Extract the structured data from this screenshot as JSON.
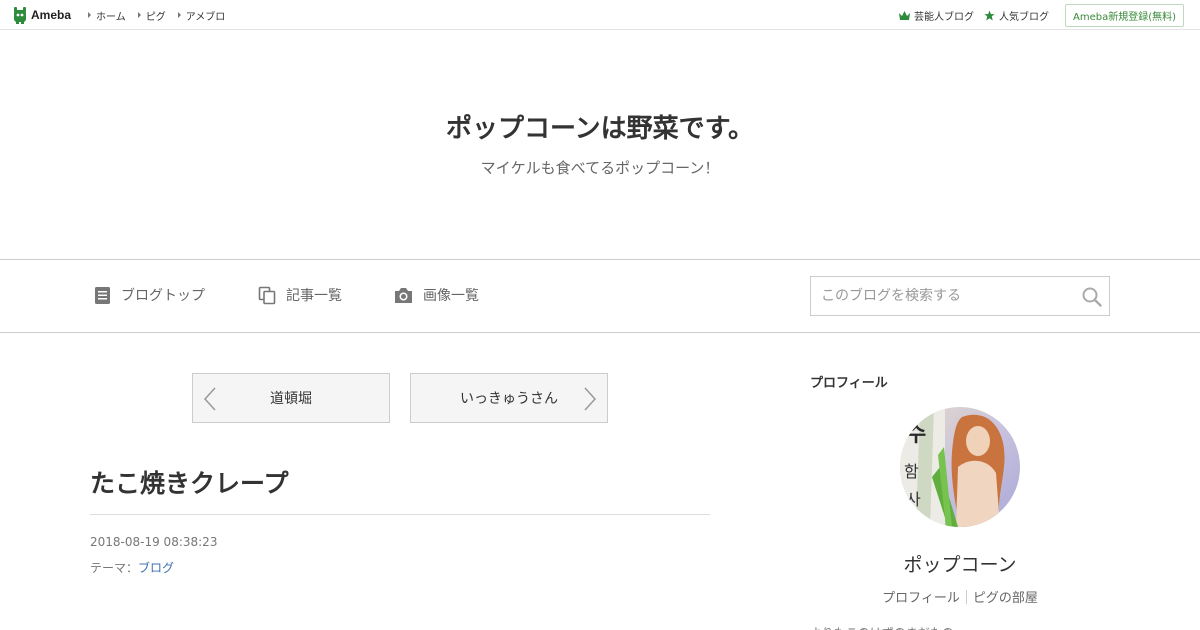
{
  "topbar": {
    "logo_text": "Ameba",
    "nav": [
      {
        "label": "ホーム"
      },
      {
        "label": "ピグ"
      },
      {
        "label": "アメブロ"
      }
    ],
    "right": {
      "celebrity_blog": "芸能人ブログ",
      "popular_blog": "人気ブログ",
      "register": "Ameba新規登録(無料)"
    },
    "accent_color": "#2d8c3c"
  },
  "header": {
    "title": "ポップコーンは野菜です。",
    "description": "マイケルも食べてるポップコーン！"
  },
  "global_nav": {
    "items": [
      {
        "label": "ブログトップ",
        "icon": "document-icon"
      },
      {
        "label": "記事一覧",
        "icon": "copy-icon"
      },
      {
        "label": "画像一覧",
        "icon": "camera-icon"
      }
    ],
    "search_placeholder": "このブログを検索する"
  },
  "pager": {
    "prev": "道頓堀",
    "next": "いっきゅうさん"
  },
  "entry": {
    "title": "たこ焼きクレープ",
    "date": "2018-08-19 08:38:23",
    "theme_label": "テーマ：",
    "theme_link": "ブログ"
  },
  "sidebar": {
    "heading": "プロフィール",
    "name": "ポップコーン",
    "links": [
      "プロフィール",
      "ピグの部屋"
    ],
    "cut_text": "よりもこのはずのまだたの"
  }
}
